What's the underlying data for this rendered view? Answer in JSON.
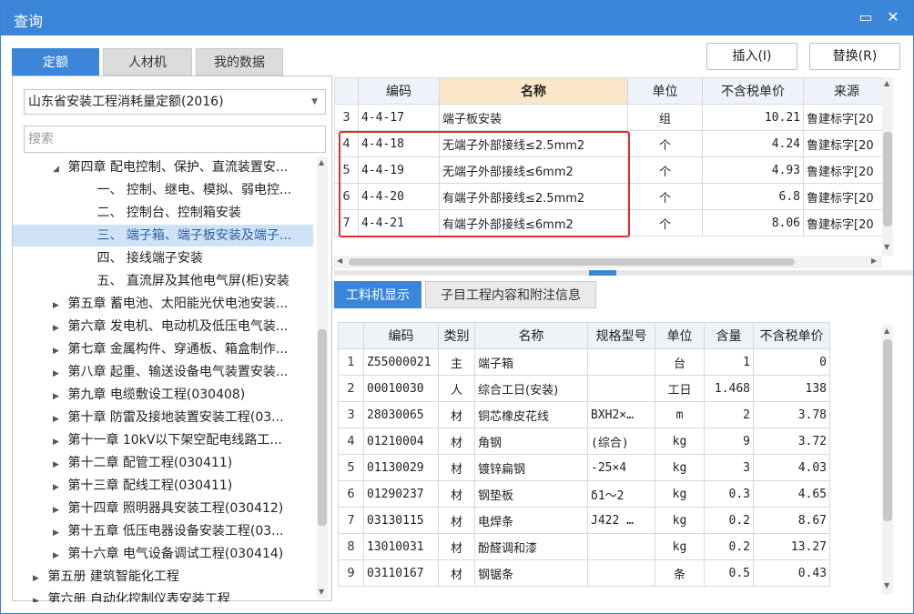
{
  "window": {
    "title": "查询",
    "min_icon": "minimize-icon",
    "close_icon": "close-icon"
  },
  "tabs": [
    {
      "label": "定额"
    },
    {
      "label": "人材机"
    },
    {
      "label": "我的数据"
    }
  ],
  "buttons": {
    "insert": "插入(I)",
    "replace": "替换(R)"
  },
  "left": {
    "selected_db": "山东省安装工程消耗量定额(2016)",
    "search_placeholder": "搜索",
    "tree": [
      {
        "indent": 2,
        "tri": "◢",
        "label": "第四章 配电控制、保护、直流装置安..."
      },
      {
        "indent": 3,
        "tri": "",
        "label": "一、 控制、继电、模拟、弱电控..."
      },
      {
        "indent": 3,
        "tri": "",
        "label": "二、 控制台、控制箱安装"
      },
      {
        "indent": 3,
        "tri": "",
        "label": "三、 端子箱、端子板安装及端子...",
        "selected": true
      },
      {
        "indent": 3,
        "tri": "",
        "label": "四、 接线端子安装"
      },
      {
        "indent": 3,
        "tri": "",
        "label": "五、 直流屏及其他电气屏(柜)安装"
      },
      {
        "indent": 2,
        "tri": "▶",
        "label": "第五章 蓄电池、太阳能光伏电池安装..."
      },
      {
        "indent": 2,
        "tri": "▶",
        "label": "第六章 发电机、电动机及低压电气装..."
      },
      {
        "indent": 2,
        "tri": "▶",
        "label": "第七章 金属构件、穿通板、箱盒制作..."
      },
      {
        "indent": 2,
        "tri": "▶",
        "label": "第八章 起重、输送设备电气装置安装..."
      },
      {
        "indent": 2,
        "tri": "▶",
        "label": "第九章 电缆敷设工程(030408)"
      },
      {
        "indent": 2,
        "tri": "▶",
        "label": "第十章 防雷及接地装置安装工程(03..."
      },
      {
        "indent": 2,
        "tri": "▶",
        "label": "第十一章 10kV以下架空配电线路工..."
      },
      {
        "indent": 2,
        "tri": "▶",
        "label": "第十二章 配管工程(030411)"
      },
      {
        "indent": 2,
        "tri": "▶",
        "label": "第十三章 配线工程(030411)"
      },
      {
        "indent": 2,
        "tri": "▶",
        "label": "第十四章 照明器具安装工程(030412)"
      },
      {
        "indent": 2,
        "tri": "▶",
        "label": "第十五章 低压电器设备安装工程(03..."
      },
      {
        "indent": 2,
        "tri": "▶",
        "label": "第十六章 电气设备调试工程(030414)"
      },
      {
        "indent": 1,
        "tri": "▶",
        "label": "第五册 建筑智能化工程"
      },
      {
        "indent": 1,
        "tri": "▶",
        "label": "第六册 自动化控制仪表安装工程"
      }
    ]
  },
  "top_grid": {
    "headers": [
      "编码",
      "名称",
      "单位",
      "不含税单价",
      "来源"
    ],
    "rows": [
      {
        "n": "3",
        "code": "4-4-17",
        "name": "端子板安装",
        "unit": "组",
        "price": "10.21",
        "src": "鲁建标字[20"
      },
      {
        "n": "4",
        "code": "4-4-18",
        "name": "无端子外部接线≤2.5mm2",
        "unit": "个",
        "price": "4.24",
        "src": "鲁建标字[20"
      },
      {
        "n": "5",
        "code": "4-4-19",
        "name": "无端子外部接线≤6mm2",
        "unit": "个",
        "price": "4.93",
        "src": "鲁建标字[20"
      },
      {
        "n": "6",
        "code": "4-4-20",
        "name": "有端子外部接线≤2.5mm2",
        "unit": "个",
        "price": "6.8",
        "src": "鲁建标字[20"
      },
      {
        "n": "7",
        "code": "4-4-21",
        "name": "有端子外部接线≤6mm2",
        "unit": "个",
        "price": "8.06",
        "src": "鲁建标字[20"
      }
    ]
  },
  "lower_tabs": [
    {
      "label": "工料机显示"
    },
    {
      "label": "子目工程内容和附注信息"
    }
  ],
  "bottom_grid": {
    "headers": [
      "编码",
      "类别",
      "名称",
      "规格型号",
      "单位",
      "含量",
      "不含税单价"
    ],
    "rows": [
      {
        "n": "1",
        "code": "Z55000021",
        "type": "主",
        "name": "端子箱",
        "spec": "",
        "unit": "台",
        "qty": "1",
        "price": "0"
      },
      {
        "n": "2",
        "code": "00010030",
        "type": "人",
        "name": "综合工日(安装)",
        "spec": "",
        "unit": "工日",
        "qty": "1.468",
        "price": "138"
      },
      {
        "n": "3",
        "code": "28030065",
        "type": "材",
        "name": "铜芯橡皮花线",
        "spec": "BXH2×…",
        "unit": "m",
        "qty": "2",
        "price": "3.78"
      },
      {
        "n": "4",
        "code": "01210004",
        "type": "材",
        "name": "角钢",
        "spec": "(综合)",
        "unit": "kg",
        "qty": "9",
        "price": "3.72"
      },
      {
        "n": "5",
        "code": "01130029",
        "type": "材",
        "name": "镀锌扁钢",
        "spec": "-25×4",
        "unit": "kg",
        "qty": "3",
        "price": "4.03"
      },
      {
        "n": "6",
        "code": "01290237",
        "type": "材",
        "name": "钢垫板",
        "spec": "δ1～2",
        "unit": "kg",
        "qty": "0.3",
        "price": "4.65"
      },
      {
        "n": "7",
        "code": "03130115",
        "type": "材",
        "name": "电焊条",
        "spec": "J422 …",
        "unit": "kg",
        "qty": "0.2",
        "price": "8.67"
      },
      {
        "n": "8",
        "code": "13010031",
        "type": "材",
        "name": "酚醛调和漆",
        "spec": "",
        "unit": "kg",
        "qty": "0.2",
        "price": "13.27"
      },
      {
        "n": "9",
        "code": "03110167",
        "type": "材",
        "name": "钢锯条",
        "spec": "",
        "unit": "条",
        "qty": "0.5",
        "price": "0.43"
      }
    ]
  }
}
